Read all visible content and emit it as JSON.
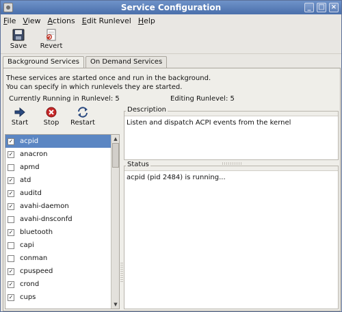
{
  "window": {
    "title": "Service Configuration",
    "wm_buttons": {
      "minimize": "_",
      "maximize": "□",
      "close": "×"
    }
  },
  "menu": [
    "File",
    "View",
    "Actions",
    "Edit Runlevel",
    "Help"
  ],
  "toolbar": {
    "save_label": "Save",
    "revert_label": "Revert"
  },
  "tabs": [
    {
      "label": "Background Services",
      "active": true
    },
    {
      "label": "On Demand Services",
      "active": false
    }
  ],
  "panel": {
    "info_line1": "These services are started once and run in the background.",
    "info_line2": "You can specify in which runlevels they are started.",
    "running": "Currently Running in Runlevel: 5",
    "editing": "Editing Runlevel: 5"
  },
  "service_tools": {
    "start_label": "Start",
    "stop_label": "Stop",
    "restart_label": "Restart"
  },
  "services": [
    {
      "name": "acpid",
      "checked": true,
      "selected": true
    },
    {
      "name": "anacron",
      "checked": true,
      "selected": false
    },
    {
      "name": "apmd",
      "checked": false,
      "selected": false
    },
    {
      "name": "atd",
      "checked": true,
      "selected": false
    },
    {
      "name": "auditd",
      "checked": true,
      "selected": false
    },
    {
      "name": "avahi-daemon",
      "checked": true,
      "selected": false
    },
    {
      "name": "avahi-dnsconfd",
      "checked": false,
      "selected": false
    },
    {
      "name": "bluetooth",
      "checked": true,
      "selected": false
    },
    {
      "name": "capi",
      "checked": false,
      "selected": false
    },
    {
      "name": "conman",
      "checked": false,
      "selected": false
    },
    {
      "name": "cpuspeed",
      "checked": true,
      "selected": false
    },
    {
      "name": "crond",
      "checked": true,
      "selected": false
    },
    {
      "name": "cups",
      "checked": true,
      "selected": false
    }
  ],
  "description": {
    "label": "Description",
    "text": "Listen and dispatch ACPI events from the kernel"
  },
  "status": {
    "label": "Status",
    "text": "acpid (pid 2484) is running..."
  },
  "colors": {
    "titlebar": "#5a7fbf",
    "selection": "#5b86c3",
    "window_bg": "#e9e7e3"
  }
}
